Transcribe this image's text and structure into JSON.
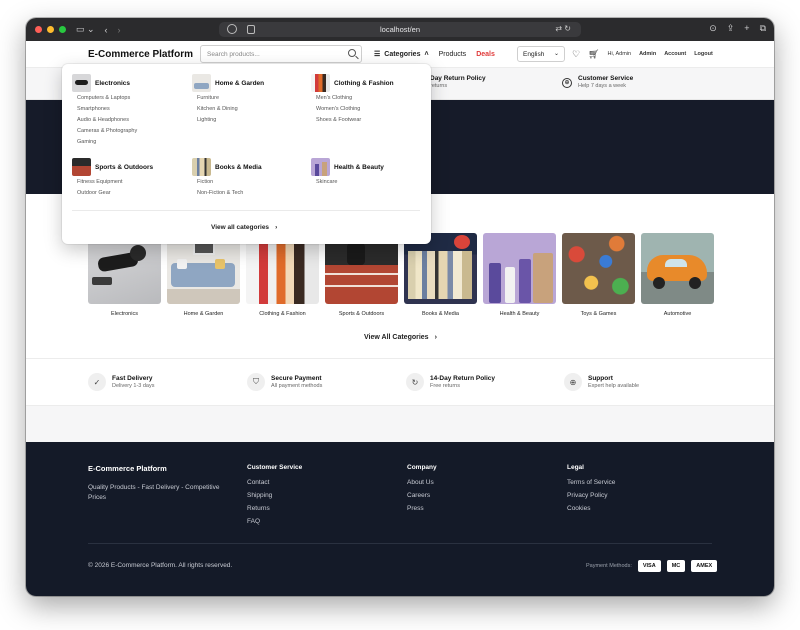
{
  "browser": {
    "url": "localhost/en",
    "traffic_colors": [
      "#ff5f57",
      "#febc2e",
      "#28c840"
    ]
  },
  "header": {
    "brand": "E-Commerce Platform",
    "search_placeholder": "Search products...",
    "nav": {
      "categories": "Categories",
      "products": "Products",
      "deals": "Deals"
    },
    "language": "English",
    "greeting": "Hi, Admin",
    "links": [
      "Admin",
      "Account",
      "Logout"
    ]
  },
  "info_strip": {
    "return_title": "Day Return Policy",
    "return_sub": "returns",
    "service_title": "Customer Service",
    "service_sub": "Help 7 days a week"
  },
  "mega_menu": {
    "groups": [
      {
        "title": "Electronics",
        "items": [
          "Computers & Laptops",
          "Smartphones",
          "Audio & Headphones",
          "Cameras & Photography",
          "Gaming"
        ]
      },
      {
        "title": "Home & Garden",
        "items": [
          "Furniture",
          "Kitchen & Dining",
          "Lighting"
        ]
      },
      {
        "title": "Clothing & Fashion",
        "items": [
          "Men's Clothing",
          "Women's Clothing",
          "Shoes & Footwear"
        ]
      },
      {
        "title": "Sports & Outdoors",
        "items": [
          "Fitness Equipment",
          "Outdoor Gear"
        ]
      },
      {
        "title": "Books & Media",
        "items": [
          "Fiction",
          "Non-Fiction & Tech"
        ]
      },
      {
        "title": "Health & Beauty",
        "items": [
          "Skincare"
        ]
      }
    ],
    "view_all": "View all categories"
  },
  "categories": [
    {
      "label": "Electronics"
    },
    {
      "label": "Home & Garden"
    },
    {
      "label": "Clothing & Fashion"
    },
    {
      "label": "Sports & Outdoors"
    },
    {
      "label": "Books & Media"
    },
    {
      "label": "Health & Beauty"
    },
    {
      "label": "Toys & Games"
    },
    {
      "label": "Automotive"
    }
  ],
  "view_all_categories": "View All Categories",
  "features": [
    {
      "title": "Fast Delivery",
      "sub": "Delivery 1-3 days",
      "icon": "check-icon"
    },
    {
      "title": "Secure Payment",
      "sub": "All payment methods",
      "icon": "shield-icon"
    },
    {
      "title": "14-Day Return Policy",
      "sub": "Free returns",
      "icon": "refresh-icon"
    },
    {
      "title": "Support",
      "sub": "Expert help available",
      "icon": "globe-icon"
    }
  ],
  "footer": {
    "brand": "E-Commerce Platform",
    "tagline": "Quality Products - Fast Delivery - Competitive Prices",
    "customer_service": {
      "title": "Customer Service",
      "links": [
        "Contact",
        "Shipping",
        "Returns",
        "FAQ"
      ]
    },
    "company": {
      "title": "Company",
      "links": [
        "About Us",
        "Careers",
        "Press"
      ]
    },
    "legal": {
      "title": "Legal",
      "links": [
        "Terms of Service",
        "Privacy Policy",
        "Cookies"
      ]
    },
    "copyright": "© 2026 E-Commerce Platform. All rights reserved.",
    "payment_label": "Payment Methods:",
    "payment_methods": [
      "VISA",
      "MC",
      "AMEX"
    ]
  }
}
